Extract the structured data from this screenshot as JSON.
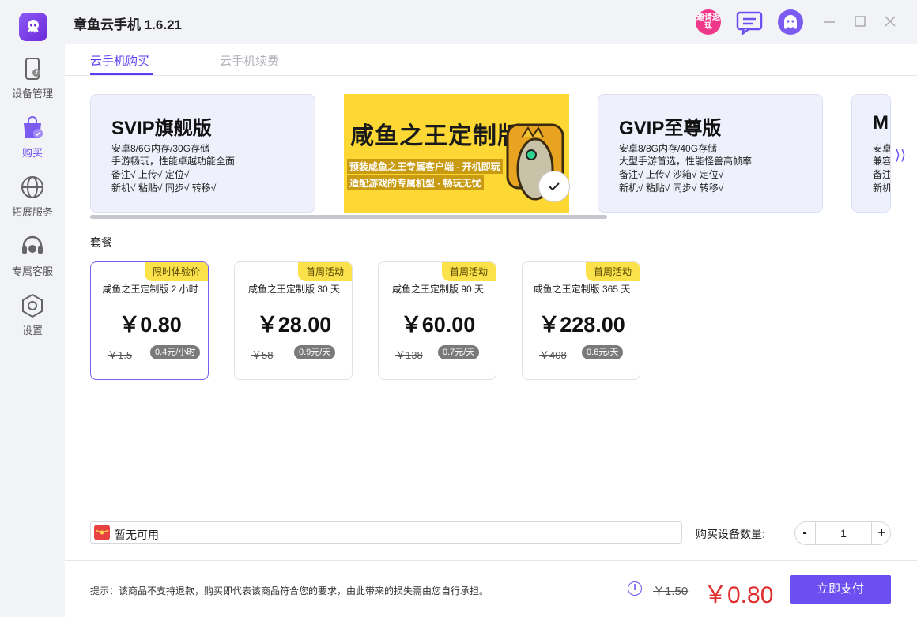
{
  "app": {
    "title": "章鱼云手机 1.6.21",
    "invite_badge": "邀请返现"
  },
  "sidebar": {
    "items": [
      {
        "label": "设备管理",
        "icon": "phone-device-icon"
      },
      {
        "label": "购买",
        "icon": "shopping-bag-icon",
        "active": true
      },
      {
        "label": "拓展服务",
        "icon": "globe-icon"
      },
      {
        "label": "专属客服",
        "icon": "headset-icon"
      },
      {
        "label": "设置",
        "icon": "hexagon-gear-icon"
      }
    ]
  },
  "tabs": [
    {
      "label": "云手机购买",
      "active": true
    },
    {
      "label": "云手机续费",
      "active": false
    }
  ],
  "tiers": [
    {
      "name": "SVIP旗舰版",
      "lines": [
        "安卓8/6G内存/30G存储",
        "手游畅玩，性能卓越功能全面",
        "备注√  上传√  定位√",
        "新机√  粘贴√  同步√   转移√"
      ]
    },
    {
      "name": "咸鱼之王定制版",
      "lines": [
        "预装咸鱼之王专属客户端 - 开机即玩",
        "适配游戏的专属机型 - 畅玩无忧"
      ],
      "selected": true
    },
    {
      "name": "GVIP至尊版",
      "lines": [
        "安卓8/8G内存/40G存储",
        "大型手游首选，性能怪兽高帧率",
        "备注√  上传√  沙箱√  定位√",
        "新机√  粘贴√  同步√   转移√"
      ]
    },
    {
      "name": "M",
      "lines": [
        "安卓",
        "兼容",
        "备注",
        "新机"
      ]
    }
  ],
  "packages_label": "套餐",
  "packages": [
    {
      "badge": "限时体验价",
      "name": "咸鱼之王定制版 2 小时",
      "price": "￥0.80",
      "original": "￥1.5",
      "unit_price": "0.4元/小时",
      "selected": true
    },
    {
      "badge": "首周活动",
      "name": "咸鱼之王定制版 30 天",
      "price": "￥28.00",
      "original": "￥58",
      "unit_price": "0.9元/天"
    },
    {
      "badge": "首周活动",
      "name": "咸鱼之王定制版 90 天",
      "price": "￥60.00",
      "original": "￥138",
      "unit_price": "0.7元/天"
    },
    {
      "badge": "首周活动",
      "name": "咸鱼之王定制版 365 天",
      "price": "￥228.00",
      "original": "￥408",
      "unit_price": "0.6元/天"
    }
  ],
  "coupon": {
    "text": "暂无可用"
  },
  "quantity": {
    "label": "购买设备数量:",
    "value": "1",
    "minus": "-",
    "plus": "+"
  },
  "footer": {
    "notice": "提示：该商品不支持退款，购买即代表该商品符合您的要求，由此带来的损失需由您自行承担。",
    "info": "i",
    "original_total": "￥1.50",
    "total": "￥0.80",
    "pay_label": "立即支付"
  },
  "colors": {
    "accent": "#6b4ff0",
    "price_red": "#e02d2d",
    "badge_yellow": "#fbe24a",
    "tier_bg": "#eef0fc"
  }
}
